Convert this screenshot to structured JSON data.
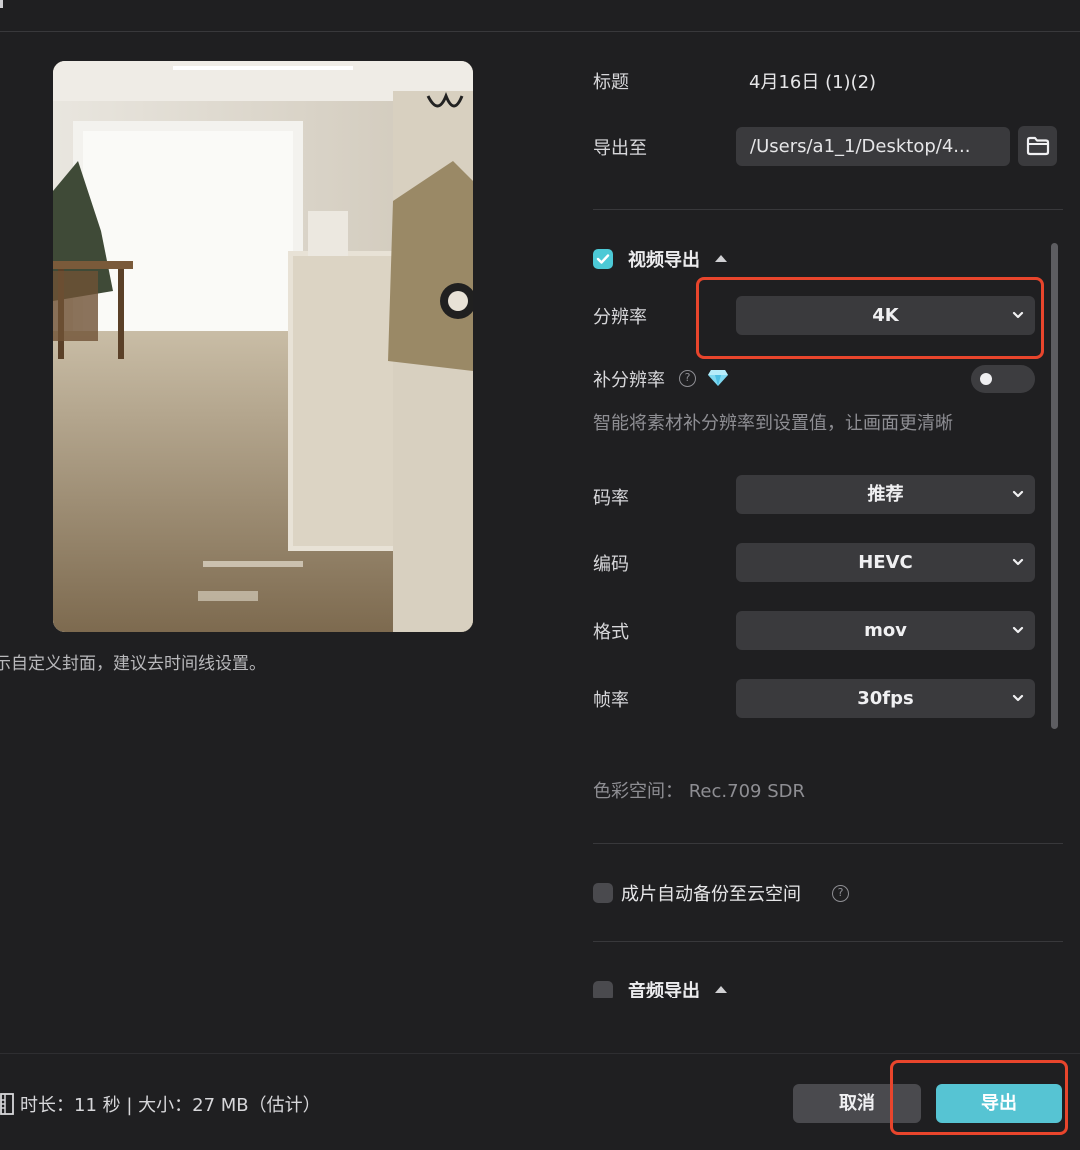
{
  "preview": {
    "cover_hint": "示自定义封面，建议去时间线设置。",
    "image_alt": "room-photo"
  },
  "form": {
    "title_label": "标题",
    "title_value": "4月16日 (1)(2)",
    "export_to_label": "导出至",
    "export_path": "/Users/a1_1/Desktop/4..."
  },
  "video_section": {
    "title": "视频导出",
    "checked": true,
    "resolution_label": "分辨率",
    "resolution_value": "4K",
    "super_res_label": "补分辨率",
    "super_res_hint": "智能将素材补分辨率到设置值，让画面更清晰",
    "bitrate_label": "码率",
    "bitrate_value": "推荐",
    "codec_label": "编码",
    "codec_value": "HEVC",
    "format_label": "格式",
    "format_value": "mov",
    "framerate_label": "帧率",
    "framerate_value": "30fps",
    "color_space": "色彩空间： Rec.709 SDR"
  },
  "backup": {
    "label": "成片自动备份至云空间",
    "checked": false
  },
  "audio_section": {
    "title": "音频导出",
    "checked": false
  },
  "footer": {
    "info": "时长：11 秒 | 大小：27 MB（估计）",
    "cancel_label": "取消",
    "export_label": "导出"
  },
  "colors": {
    "accent": "#56c4d3",
    "highlight": "#e8452c",
    "background": "#1f1f21"
  },
  "icons": {
    "folder": "folder-icon",
    "help": "help-circle-icon",
    "diamond": "diamond-icon",
    "film": "film-icon",
    "chevron": "chevron-down-icon"
  }
}
